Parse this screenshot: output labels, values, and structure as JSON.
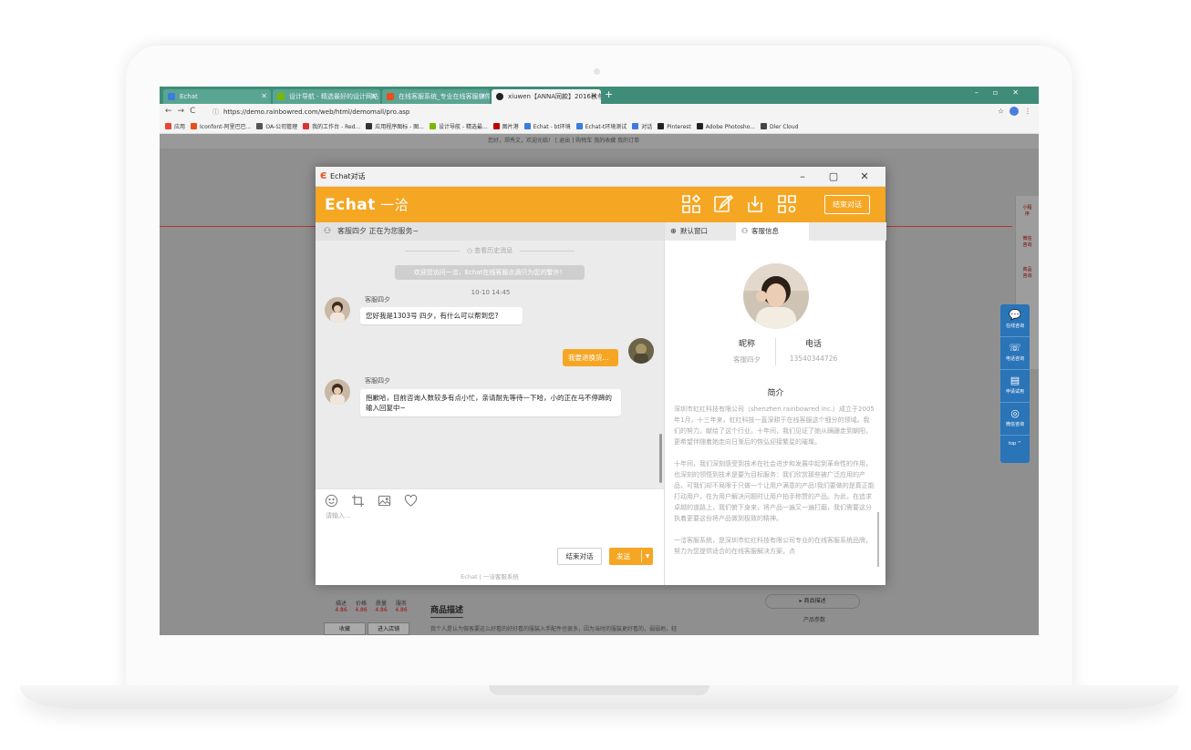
{
  "browser": {
    "tabs": [
      {
        "label": "Echat",
        "color": "#3c7be0",
        "active": false
      },
      {
        "label": "设计导航 - 精选最好的设计网站",
        "color": "#7ab800",
        "active": false
      },
      {
        "label": "在线客服系统_专业在线客服软件",
        "color": "#e94e1b",
        "active": false
      },
      {
        "label": "xiuwen【ANNA同款】2016秋冬",
        "color": "#222222",
        "active": true
      }
    ],
    "url": "https://demo.rainbowred.com/web/html/demomall/pro.asp",
    "bookmarks": [
      {
        "label": "应用",
        "color": "#ea4335"
      },
      {
        "label": "Iconfont-阿里巴巴...",
        "color": "#e94e1b"
      },
      {
        "label": "OA-公司管理",
        "color": "#555555"
      },
      {
        "label": "我的工作台 - Red...",
        "color": "#d33"
      },
      {
        "label": "应用程序图标 - 图...",
        "color": "#333333"
      },
      {
        "label": "设计导航 - 精选最...",
        "color": "#7ab800"
      },
      {
        "label": "图片港",
        "color": "#c00000"
      },
      {
        "label": "Echat - bt环境",
        "color": "#3c7be0"
      },
      {
        "label": "Echat-t环境测试",
        "color": "#3c7be0"
      },
      {
        "label": "对话",
        "color": "#3c7be0"
      },
      {
        "label": "Pinterest",
        "color": "#222222"
      },
      {
        "label": "Adobe Photosho...",
        "color": "#222222"
      },
      {
        "label": "Dler Cloud",
        "color": "#444444"
      }
    ]
  },
  "page": {
    "topline": "您好，郑秀文，欢迎光临！   [ 退出 ]          购物车        我的收藏        我的订单",
    "sidebar": [
      "小程序",
      "微信咨询",
      "商品咨询"
    ],
    "float_panel": [
      "在线咨询",
      "电话咨询",
      "申请试用",
      "微信咨询",
      "top ^"
    ],
    "scores": {
      "labels": [
        "描述",
        "价格",
        "质量",
        "服务"
      ],
      "values": [
        "4.86",
        "4.86",
        "4.86",
        "4.86"
      ]
    },
    "buttons": {
      "collect": "收藏",
      "enter_store": "进入店铺"
    },
    "desc_title": "商品描述",
    "desc_text": "我个人是认为做客要这么好看的好好看的服装入手配件也很多，因为当时的服装更好看的，弱弱地，轻",
    "right_menu": "▸ 商品描述",
    "right_menu2": "产品参数"
  },
  "chat": {
    "window_title": "Echat对话",
    "brand": "Echat",
    "brand_sub": "一洽",
    "end_label_top": "结束对话",
    "agent_status": "客服四夕 正在为您服务~",
    "history_label": "查看历史消息",
    "welcome": "欢迎您访问一洽，Echat在线客服点滴只为您的警许！",
    "timestamp": "10-10 14:45",
    "messages": [
      {
        "sender": "客服四夕",
        "text": "您好我是1303号 四夕，有什么可以帮到您?"
      },
      {
        "sender": "me",
        "text": "我要退换货..."
      },
      {
        "sender": "客服四夕",
        "text": "抱歉哈，目前咨询人数较多有点小忙，亲请耐先等待一下哈，小的正在马不停蹄的输入回复中~"
      }
    ],
    "input_placeholder": "请输入...",
    "end_button": "结束对话",
    "send_button": "发送",
    "footer": "Echat | 一洽客服系统"
  },
  "info": {
    "tab_default": "默认窗口",
    "tab_agent": "客服信息",
    "nickname_label": "昵称",
    "nickname_value": "客服四夕",
    "phone_label": "电话",
    "phone_value": "13540344726",
    "intro_title": "简介",
    "intro_text": "深圳市虹红科技有限公司（shenzhen rainbowred inc.）成立于2005年1月，十三年来，虹红科技一直深耕于在线客服这个细分的领域。我们的努力，献给了这个行业。十年间，我们见证了她从蹒跚走到朝阳，更希望伴随着她走向日渐后的恢弘迎接繁星的璀璨。\n\n十年间，我们深刻感受到技术在社会进步和发展中起到革命性的作用，也深刻的领悟到技术是要为目标服务：我们欣赏那些被广泛应用的产品，可我们却不局限于只做一个让用户满意的产品!我们要做的是真正能打动用户，在为用户解决问题时让用户拍手称赞的产品。为此，在追求卓越的道路上，我们俯下身来，将产品一遍又一遍打磨，我们需要这分执着更要这份将产品做到极致的精神。\n\n一洽客服系统，是深圳市虹红科技有限公司专业的在线客服系统品牌，努力为您提供适合的在线客服解决方案，点"
  },
  "colors": {
    "accent": "#f5a623",
    "brand_red": "#e94e1b",
    "panel_blue": "#2a74b8"
  }
}
